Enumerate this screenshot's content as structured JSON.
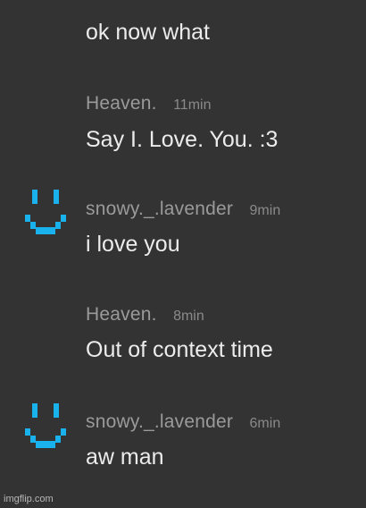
{
  "messages": [
    {
      "author": "",
      "time": "",
      "text": "ok now what"
    },
    {
      "author": "Heaven.",
      "time": "11min",
      "text": "Say I. Love. You. :3"
    },
    {
      "author": "snowy._.lavender",
      "time": "9min",
      "text": "i love you",
      "avatar": "pixel-smiley-icon"
    },
    {
      "author": "Heaven.",
      "time": "8min",
      "text": "Out of context time"
    },
    {
      "author": "snowy._.lavender",
      "time": "6min",
      "text": "aw man",
      "avatar": "pixel-smiley-icon"
    }
  ],
  "colors": {
    "background": "#333333",
    "avatar": "#1ab2ec"
  },
  "watermark": "imgflip.com"
}
